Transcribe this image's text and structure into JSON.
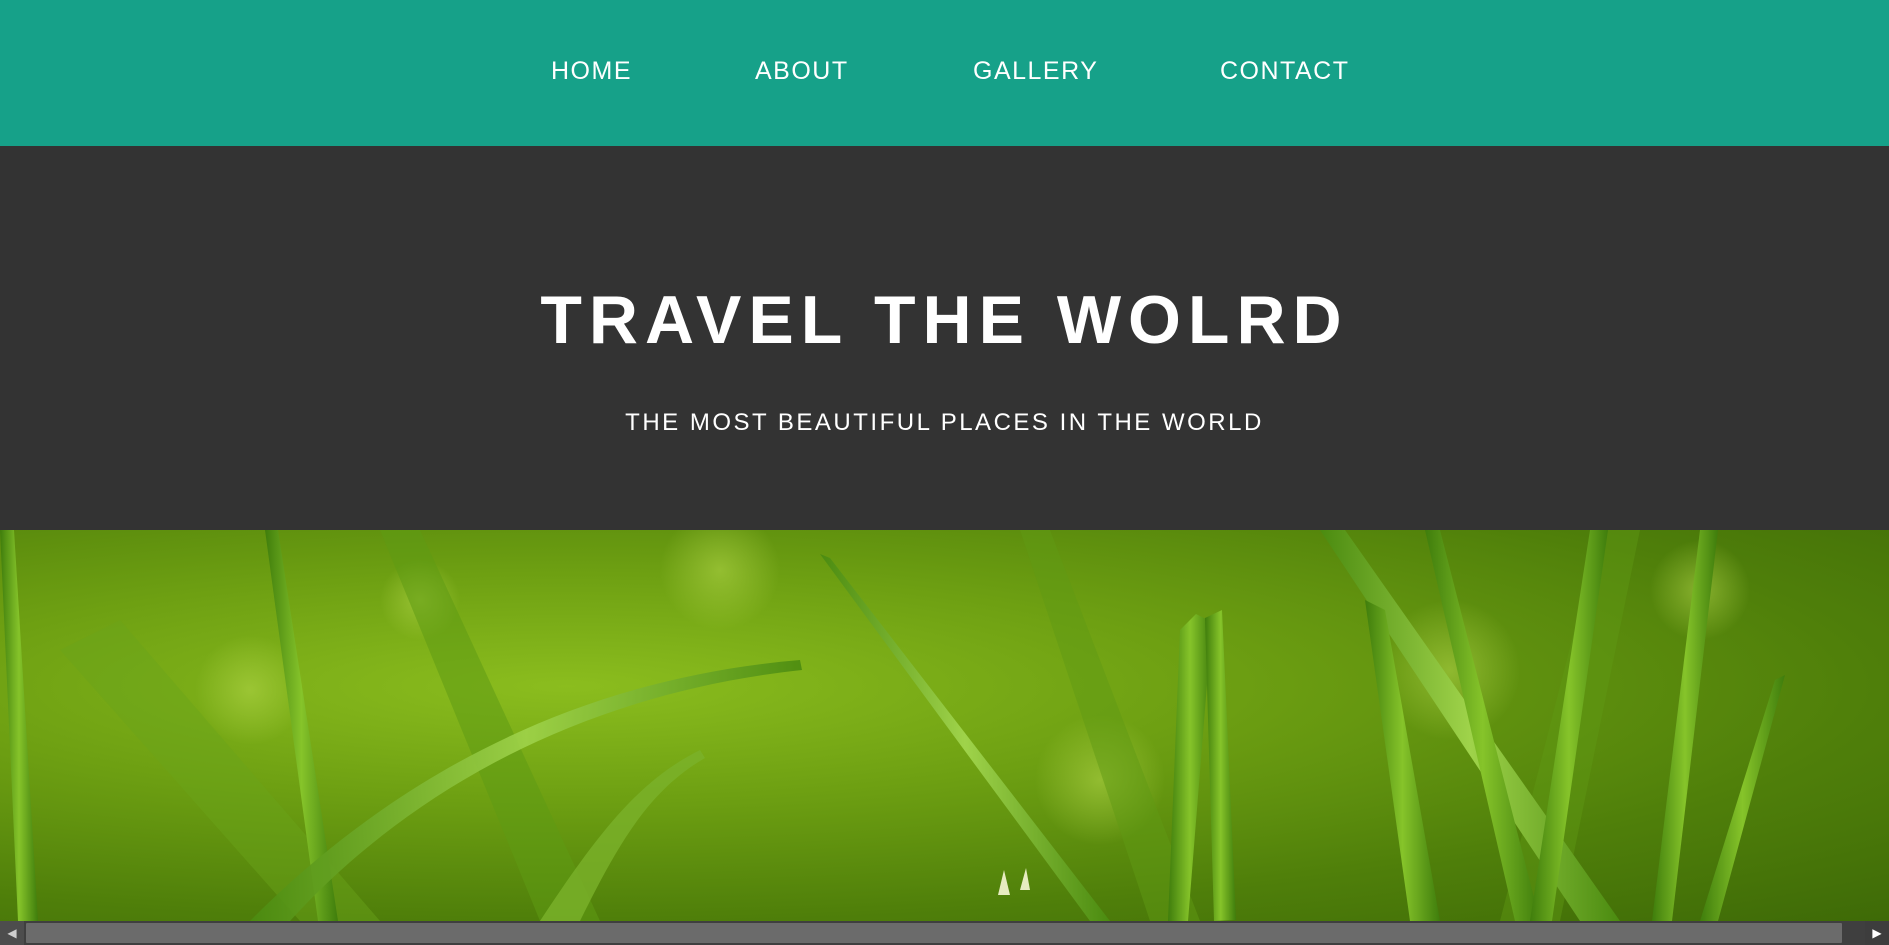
{
  "nav": {
    "items": [
      {
        "label": "HOME"
      },
      {
        "label": "ABOUT"
      },
      {
        "label": "GALLERY"
      },
      {
        "label": "CONTACT"
      }
    ],
    "background_color": "#16a189"
  },
  "hero": {
    "title": "TRAVEL THE WOLRD",
    "subtitle": "THE MOST BEAUTIFUL PLACES IN THE WORLD",
    "background_color": "#333333"
  },
  "banner": {
    "image_subject": "green-grass-closeup"
  },
  "scrollbar": {
    "left_arrow_icon": "arrow-left-icon",
    "right_arrow_icon": "arrow-right-icon"
  }
}
